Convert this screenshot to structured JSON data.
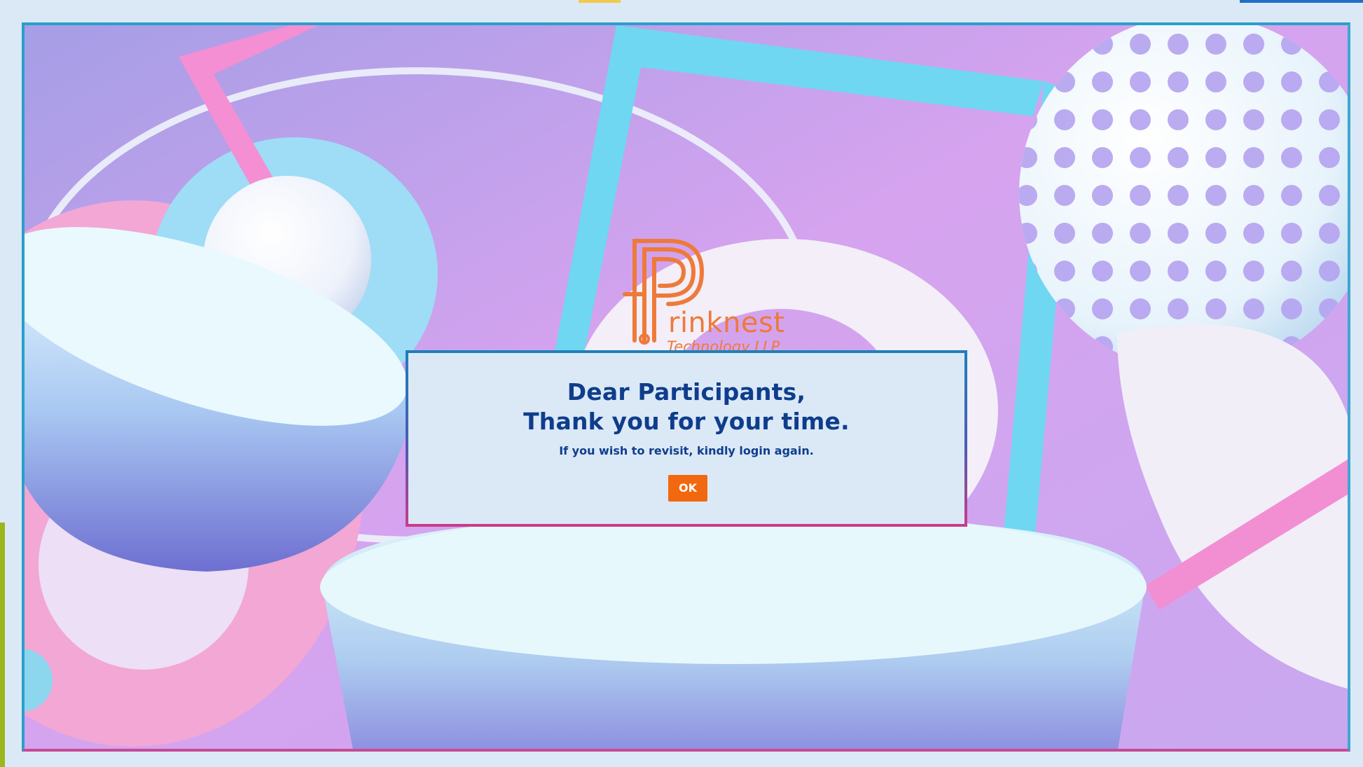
{
  "colors": {
    "page_bg": "#dbe9f7",
    "heading": "#0f3d8c",
    "button": "#f2680f",
    "brand_orange": "#ee7a3a",
    "top_accent": "#f2c94c",
    "right_accent": "#1f6fc8",
    "left_accent": "#9ab71e"
  },
  "brand": {
    "name": "rinknest",
    "tagline": "Technology LLP",
    "logo_icon": "prinknest-p-icon"
  },
  "dialog": {
    "heading_line1": "Dear Participants,",
    "heading_line2": "Thank you for your time.",
    "message": "If you wish to revisit, kindly login again.",
    "ok_label": "OK"
  }
}
